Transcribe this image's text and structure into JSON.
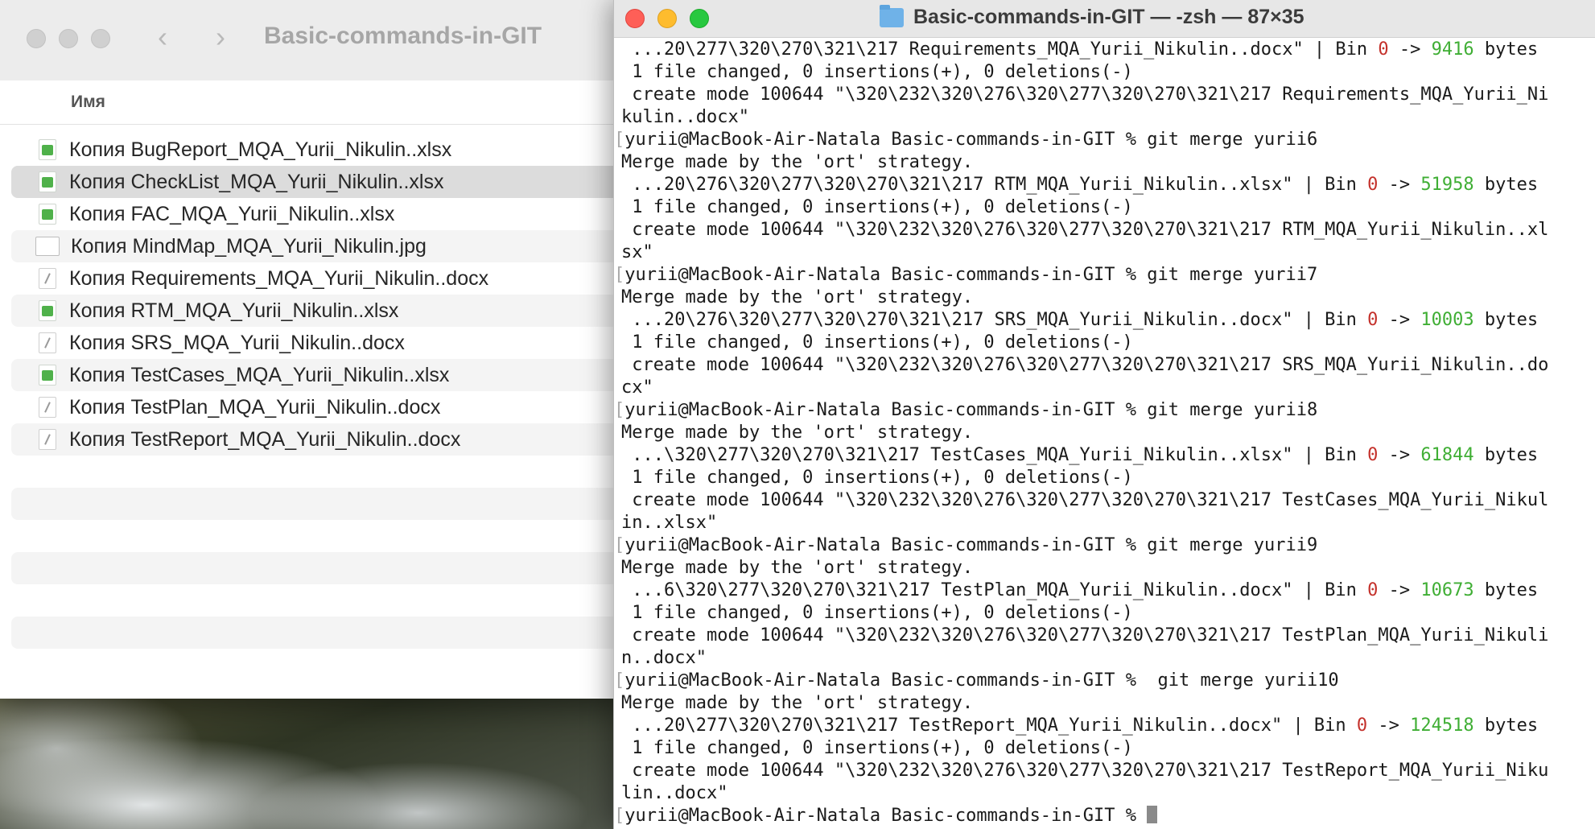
{
  "finder": {
    "title": "Basic-commands-in-GIT",
    "column_header": "Имя",
    "files": [
      {
        "name": "Копия BugReport_MQA_Yurii_Nikulin..xlsx",
        "type": "xlsx-icon"
      },
      {
        "name": "Копия CheckList_MQA_Yurii_Nikulin..xlsx",
        "type": "xlsx-icon",
        "selected": true
      },
      {
        "name": "Копия FAC_MQA_Yurii_Nikulin..xlsx",
        "type": "xlsx-icon"
      },
      {
        "name": "Копия MindMap_MQA_Yurii_Nikulin.jpg",
        "type": "jpg-icon"
      },
      {
        "name": "Копия Requirements_MQA_Yurii_Nikulin..docx",
        "type": "docx-icon"
      },
      {
        "name": "Копия RTM_MQA_Yurii_Nikulin..xlsx",
        "type": "xlsx-icon"
      },
      {
        "name": "Копия SRS_MQA_Yurii_Nikulin..docx",
        "type": "docx-icon"
      },
      {
        "name": "Копия TestCases_MQA_Yurii_Nikulin..xlsx",
        "type": "xlsx-icon"
      },
      {
        "name": "Копия TestPlan_MQA_Yurii_Nikulin..docx",
        "type": "docx-icon"
      },
      {
        "name": "Копия TestReport_MQA_Yurii_Nikulin..docx",
        "type": "docx-icon"
      }
    ]
  },
  "terminal": {
    "title": "Basic-commands-in-GIT — -zsh — 87×35",
    "colors": {
      "removed": "#c4312b",
      "added": "#3fae34"
    },
    "lines": [
      {
        "kind": "stat",
        "pre": " ...20\\277\\320\\270\\321\\217 Requirements_MQA_Yurii_Nikulin..docx\" | Bin ",
        "old": "0",
        "mid": " -> ",
        "new": "9416",
        "post": " bytes"
      },
      {
        "kind": "text",
        "text": " 1 file changed, 0 insertions(+), 0 deletions(-)"
      },
      {
        "kind": "text",
        "text": " create mode 100644 \"\\320\\232\\320\\276\\320\\277\\320\\270\\321\\217 Requirements_MQA_Yurii_Ni"
      },
      {
        "kind": "text",
        "text": "kulin..docx\""
      },
      {
        "kind": "prompt",
        "text": "yurii@MacBook-Air-Natala Basic-commands-in-GIT % git merge yurii6"
      },
      {
        "kind": "text",
        "text": "Merge made by the 'ort' strategy."
      },
      {
        "kind": "stat",
        "pre": " ...20\\276\\320\\277\\320\\270\\321\\217 RTM_MQA_Yurii_Nikulin..xlsx\" | Bin ",
        "old": "0",
        "mid": " -> ",
        "new": "51958",
        "post": " bytes"
      },
      {
        "kind": "text",
        "text": " 1 file changed, 0 insertions(+), 0 deletions(-)"
      },
      {
        "kind": "text",
        "text": " create mode 100644 \"\\320\\232\\320\\276\\320\\277\\320\\270\\321\\217 RTM_MQA_Yurii_Nikulin..xl"
      },
      {
        "kind": "text",
        "text": "sx\""
      },
      {
        "kind": "prompt",
        "text": "yurii@MacBook-Air-Natala Basic-commands-in-GIT % git merge yurii7"
      },
      {
        "kind": "text",
        "text": "Merge made by the 'ort' strategy."
      },
      {
        "kind": "stat",
        "pre": " ...20\\276\\320\\277\\320\\270\\321\\217 SRS_MQA_Yurii_Nikulin..docx\" | Bin ",
        "old": "0",
        "mid": " -> ",
        "new": "10003",
        "post": " bytes"
      },
      {
        "kind": "text",
        "text": " 1 file changed, 0 insertions(+), 0 deletions(-)"
      },
      {
        "kind": "text",
        "text": " create mode 100644 \"\\320\\232\\320\\276\\320\\277\\320\\270\\321\\217 SRS_MQA_Yurii_Nikulin..do"
      },
      {
        "kind": "text",
        "text": "cx\""
      },
      {
        "kind": "prompt",
        "text": "yurii@MacBook-Air-Natala Basic-commands-in-GIT % git merge yurii8"
      },
      {
        "kind": "text",
        "text": "Merge made by the 'ort' strategy."
      },
      {
        "kind": "stat",
        "pre": " ...\\320\\277\\320\\270\\321\\217 TestCases_MQA_Yurii_Nikulin..xlsx\" | Bin ",
        "old": "0",
        "mid": " -> ",
        "new": "61844",
        "post": " bytes"
      },
      {
        "kind": "text",
        "text": " 1 file changed, 0 insertions(+), 0 deletions(-)"
      },
      {
        "kind": "text",
        "text": " create mode 100644 \"\\320\\232\\320\\276\\320\\277\\320\\270\\321\\217 TestCases_MQA_Yurii_Nikul"
      },
      {
        "kind": "text",
        "text": "in..xlsx\""
      },
      {
        "kind": "prompt",
        "text": "yurii@MacBook-Air-Natala Basic-commands-in-GIT % git merge yurii9"
      },
      {
        "kind": "text",
        "text": "Merge made by the 'ort' strategy."
      },
      {
        "kind": "stat",
        "pre": " ...6\\320\\277\\320\\270\\321\\217 TestPlan_MQA_Yurii_Nikulin..docx\" | Bin ",
        "old": "0",
        "mid": " -> ",
        "new": "10673",
        "post": " bytes"
      },
      {
        "kind": "text",
        "text": " 1 file changed, 0 insertions(+), 0 deletions(-)"
      },
      {
        "kind": "text",
        "text": " create mode 100644 \"\\320\\232\\320\\276\\320\\277\\320\\270\\321\\217 TestPlan_MQA_Yurii_Nikuli"
      },
      {
        "kind": "text",
        "text": "n..docx\""
      },
      {
        "kind": "prompt",
        "text": "yurii@MacBook-Air-Natala Basic-commands-in-GIT %  git merge yurii10"
      },
      {
        "kind": "text",
        "text": "Merge made by the 'ort' strategy."
      },
      {
        "kind": "stat",
        "pre": " ...20\\277\\320\\270\\321\\217 TestReport_MQA_Yurii_Nikulin..docx\" | Bin ",
        "old": "0",
        "mid": " -> ",
        "new": "124518",
        "post": " bytes"
      },
      {
        "kind": "text",
        "text": " 1 file changed, 0 insertions(+), 0 deletions(-)"
      },
      {
        "kind": "text",
        "text": " create mode 100644 \"\\320\\232\\320\\276\\320\\277\\320\\270\\321\\217 TestReport_MQA_Yurii_Niku"
      },
      {
        "kind": "text",
        "text": "lin..docx\""
      },
      {
        "kind": "final",
        "text": "yurii@MacBook-Air-Natala Basic-commands-in-GIT % "
      }
    ]
  }
}
